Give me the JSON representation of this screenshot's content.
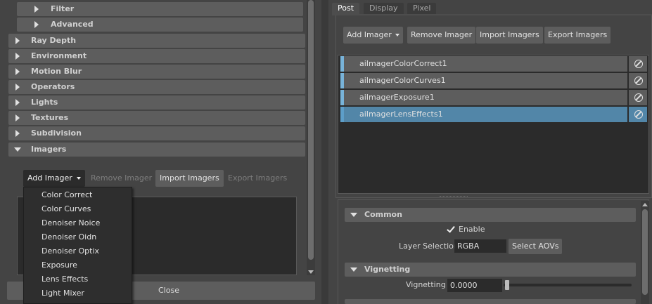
{
  "left": {
    "sections": [
      {
        "label": "Filter",
        "sub": true,
        "expanded": false
      },
      {
        "label": "Advanced",
        "sub": true,
        "expanded": false
      },
      {
        "label": "Ray Depth",
        "sub": false,
        "expanded": false
      },
      {
        "label": "Environment",
        "sub": false,
        "expanded": false
      },
      {
        "label": "Motion Blur",
        "sub": false,
        "expanded": false
      },
      {
        "label": "Operators",
        "sub": false,
        "expanded": false
      },
      {
        "label": "Lights",
        "sub": false,
        "expanded": false
      },
      {
        "label": "Textures",
        "sub": false,
        "expanded": false
      },
      {
        "label": "Subdivision",
        "sub": false,
        "expanded": false
      },
      {
        "label": "Imagers",
        "sub": false,
        "expanded": true
      }
    ],
    "toolbar": {
      "add_imager": "Add Imager",
      "remove_imager": "Remove Imager",
      "import_imagers": "Import Imagers",
      "export_imagers": "Export Imagers"
    },
    "dropdown_items": [
      "Color Correct",
      "Color Curves",
      "Denoiser Noice",
      "Denoiser Oidn",
      "Denoiser Optix",
      "Exposure",
      "Lens Effects",
      "Light Mixer"
    ],
    "close_label": "Close"
  },
  "right": {
    "tabs": [
      "Post",
      "Display",
      "Pixel"
    ],
    "active_tab": "Post",
    "toolbar": {
      "add_imager": "Add Imager",
      "remove_imager": "Remove Imager",
      "import_imagers": "Import Imagers",
      "export_imagers": "Export Imagers"
    },
    "imagers": [
      {
        "name": "aiImagerColorCorrect1",
        "selected": false
      },
      {
        "name": "aiImagerColorCurves1",
        "selected": false
      },
      {
        "name": "aiImagerExposure1",
        "selected": false
      },
      {
        "name": "aiImagerLensEffects1",
        "selected": true
      }
    ],
    "common": {
      "title": "Common",
      "enable_label": "Enable",
      "enable_checked": true,
      "layer_selection_label": "Layer Selection",
      "layer_selection_value": "RGBA",
      "select_aovs_label": "Select AOVs"
    },
    "vignetting": {
      "title": "Vignetting",
      "label": "Vignetting",
      "value": "0.0000",
      "slider_fraction": 0.0
    }
  },
  "colors": {
    "panel_bg": "#444444",
    "section_bg": "#5d5d5d",
    "field_bg": "#2b2b2b",
    "selection": "#5286a8",
    "row_accent": "#78b3d9"
  },
  "icons": [
    "expand-triangle-icon",
    "collapse-triangle-icon",
    "dropdown-caret-icon",
    "bypass-icon",
    "checkmark-icon"
  ]
}
